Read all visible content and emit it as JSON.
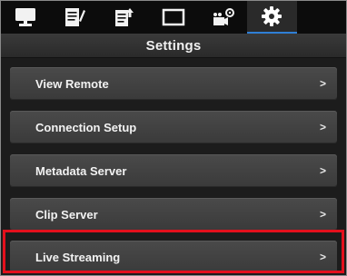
{
  "tabs": [
    {
      "icon": "monitor-icon",
      "active": false
    },
    {
      "icon": "document-pencil-icon",
      "active": false
    },
    {
      "icon": "document-export-icon",
      "active": false
    },
    {
      "icon": "rectangle-frame-icon",
      "active": false
    },
    {
      "icon": "camera-settings-icon",
      "active": false
    },
    {
      "icon": "gear-icon",
      "active": true
    }
  ],
  "header": {
    "title": "Settings"
  },
  "menu": {
    "items": [
      {
        "label": "View Remote",
        "arrow": ">"
      },
      {
        "label": "Connection Setup",
        "arrow": ">"
      },
      {
        "label": "Metadata Server",
        "arrow": ">"
      },
      {
        "label": "Clip Server",
        "arrow": ">"
      },
      {
        "label": "Live Streaming",
        "arrow": ">",
        "highlighted": true
      }
    ]
  },
  "colors": {
    "highlight": "#e3101c",
    "active_tab_accent": "#2f7fd6"
  }
}
